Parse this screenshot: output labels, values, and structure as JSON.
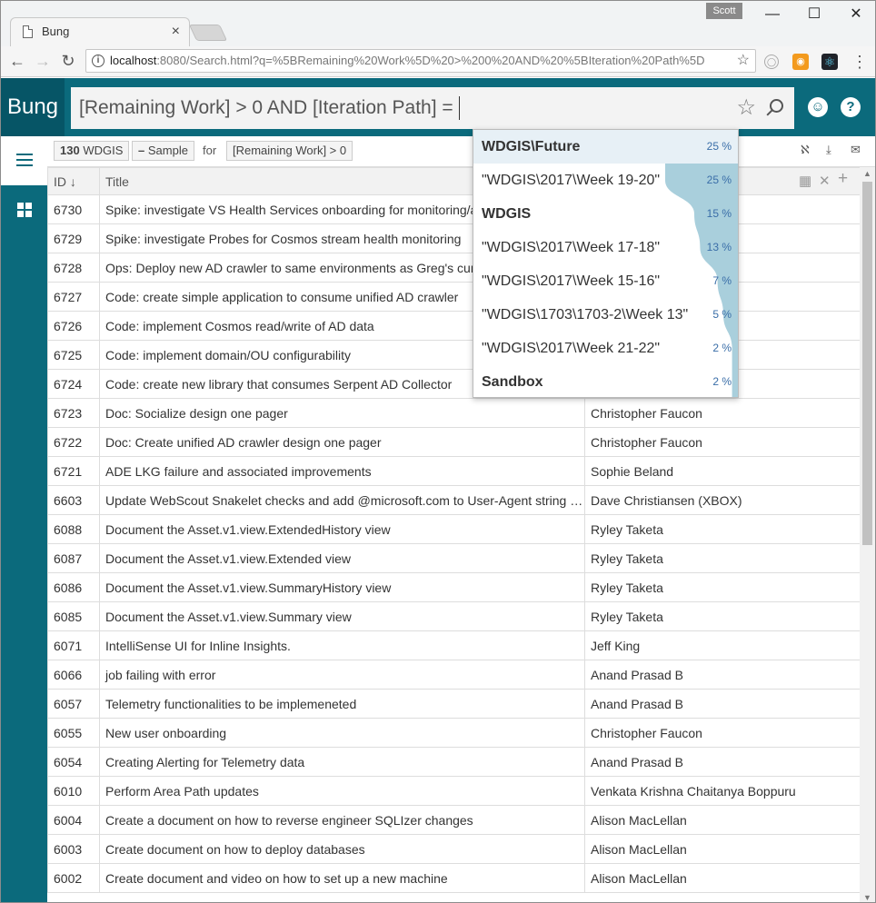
{
  "browser": {
    "tab_title": "Bung",
    "user": "Scott",
    "url_host": "localhost",
    "url_rest": ":8080/Search.html?q=%5BRemaining%20Work%5D%20>%200%20AND%20%5BIteration%20Path%5D"
  },
  "app": {
    "brand": "Bung",
    "search_query": "[Remaining Work] > 0 AND [Iteration Path] ="
  },
  "results": {
    "count": "130",
    "source": "WDGIS",
    "sample_label": "Sample",
    "for_label": "for",
    "filter": "[Remaining Work] > 0"
  },
  "columns": {
    "id": "ID ↓",
    "title": "Title"
  },
  "rows": [
    {
      "id": "6730",
      "title": "Spike: investigate VS Health Services onboarding for monitoring/a",
      "owner": ""
    },
    {
      "id": "6729",
      "title": "Spike: investigate Probes for Cosmos stream health monitoring",
      "owner": ""
    },
    {
      "id": "6728",
      "title": "Ops: Deploy new AD crawler to same environments as Greg's curr",
      "owner": ""
    },
    {
      "id": "6727",
      "title": "Code: create simple application to consume unified AD crawler",
      "owner": ""
    },
    {
      "id": "6726",
      "title": "Code: implement Cosmos read/write of AD data",
      "owner": ""
    },
    {
      "id": "6725",
      "title": "Code: implement domain/OU configurability",
      "owner": ""
    },
    {
      "id": "6724",
      "title": "Code: create new library that consumes Serpent AD Collector",
      "owner": ""
    },
    {
      "id": "6723",
      "title": "Doc: Socialize design one pager",
      "owner": "Christopher Faucon"
    },
    {
      "id": "6722",
      "title": "Doc: Create unified AD crawler design one pager",
      "owner": "Christopher Faucon"
    },
    {
      "id": "6721",
      "title": "ADE LKG failure and associated improvements",
      "owner": "Sophie Beland"
    },
    {
      "id": "6603",
      "title": "Update WebScout Snakelet checks and add @microsoft.com to User-Agent string a...",
      "owner": "Dave Christiansen (XBOX)"
    },
    {
      "id": "6088",
      "title": "Document the Asset.v1.view.ExtendedHistory view",
      "owner": "Ryley Taketa"
    },
    {
      "id": "6087",
      "title": "Document the Asset.v1.view.Extended view",
      "owner": "Ryley Taketa"
    },
    {
      "id": "6086",
      "title": "Document the Asset.v1.view.SummaryHistory view",
      "owner": "Ryley Taketa"
    },
    {
      "id": "6085",
      "title": "Document the Asset.v1.view.Summary view",
      "owner": "Ryley Taketa"
    },
    {
      "id": "6071",
      "title": "IntelliSense UI for Inline Insights.",
      "owner": "Jeff King"
    },
    {
      "id": "6066",
      "title": "job failing with error",
      "owner": "Anand Prasad B"
    },
    {
      "id": "6057",
      "title": "Telemetry functionalities to be implemeneted",
      "owner": "Anand Prasad B"
    },
    {
      "id": "6055",
      "title": "New user onboarding",
      "owner": "Christopher Faucon"
    },
    {
      "id": "6054",
      "title": "Creating Alerting for Telemetry data",
      "owner": "Anand Prasad B"
    },
    {
      "id": "6010",
      "title": "Perform Area Path updates",
      "owner": "Venkata Krishna Chaitanya Boppuru"
    },
    {
      "id": "6004",
      "title": "Create a document on how to reverse engineer SQLIzer changes",
      "owner": "Alison MacLellan"
    },
    {
      "id": "6003",
      "title": "Create document on how to deploy databases",
      "owner": "Alison MacLellan"
    },
    {
      "id": "6002",
      "title": "Create document and video on how to set up a new machine",
      "owner": "Alison MacLellan"
    }
  ],
  "suggestions": [
    {
      "label": "WDGIS\\Future",
      "pct": "25 %",
      "value": 25
    },
    {
      "label": "\"WDGIS\\2017\\Week 19-20\"",
      "pct": "25 %",
      "value": 25
    },
    {
      "label": "WDGIS",
      "pct": "15 %",
      "value": 15
    },
    {
      "label": "\"WDGIS\\2017\\Week 17-18\"",
      "pct": "13 %",
      "value": 13
    },
    {
      "label": "\"WDGIS\\2017\\Week 15-16\"",
      "pct": "7 %",
      "value": 7
    },
    {
      "label": "\"WDGIS\\1703\\1703-2\\Week 13\"",
      "pct": "5 %",
      "value": 5
    },
    {
      "label": "\"WDGIS\\2017\\Week 21-22\"",
      "pct": "2 %",
      "value": 2
    },
    {
      "label": "Sandbox",
      "pct": "2 %",
      "value": 2
    }
  ],
  "colors": {
    "brand": "#0b6a7c",
    "brand_dark": "#065566",
    "distribution": "#a9cfdc"
  }
}
